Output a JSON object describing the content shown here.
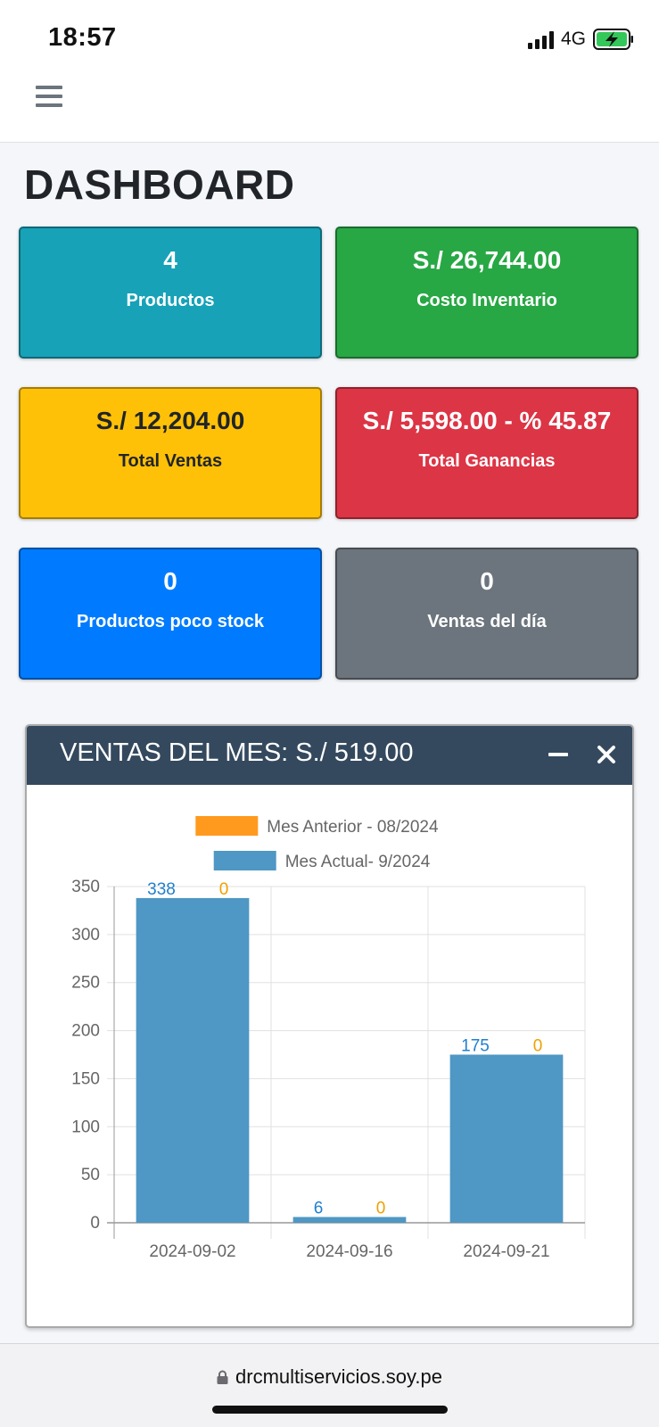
{
  "status_bar": {
    "time": "18:57",
    "network": "4G"
  },
  "page": {
    "title": "DASHBOARD"
  },
  "cards": [
    {
      "value": "4",
      "label": "Productos",
      "color": "#17a2b8"
    },
    {
      "value": "S./ 26,744.00",
      "label": "Costo Inventario",
      "color": "#28a745"
    },
    {
      "value": "S./ 12,204.00",
      "label": "Total Ventas",
      "color": "#ffc107"
    },
    {
      "value": "S./ 5,598.00 - % 45.87",
      "label": "Total Ganancias",
      "color": "#dc3545"
    },
    {
      "value": "0",
      "label": "Productos poco stock",
      "color": "#007bff"
    },
    {
      "value": "0",
      "label": "Ventas del día",
      "color": "#6c757d"
    }
  ],
  "sales_box": {
    "title": "VENTAS DEL MES: S./ 519.00",
    "header_color": "#34495e"
  },
  "chart_data": {
    "type": "bar",
    "categories": [
      "2024-09-02",
      "2024-09-16",
      "2024-09-21"
    ],
    "series": [
      {
        "name": "Mes Actual- 9/2024",
        "values": [
          338,
          6,
          175
        ],
        "color": "#4f97c4",
        "label_color": "#1f7fcf"
      },
      {
        "name": "Mes Anterior - 08/2024",
        "values": [
          0,
          0,
          0
        ],
        "color": "#ff9a1f",
        "label_color": "#f0a000"
      }
    ],
    "legend_order": [
      "Mes Anterior - 08/2024",
      "Mes Actual- 9/2024"
    ],
    "legend_position": "top-center",
    "y_ticks": [
      0,
      50,
      100,
      150,
      200,
      250,
      300,
      350
    ],
    "ylim": [
      0,
      350
    ],
    "grid": true
  },
  "browser": {
    "url": "drcmultiservicios.soy.pe"
  }
}
